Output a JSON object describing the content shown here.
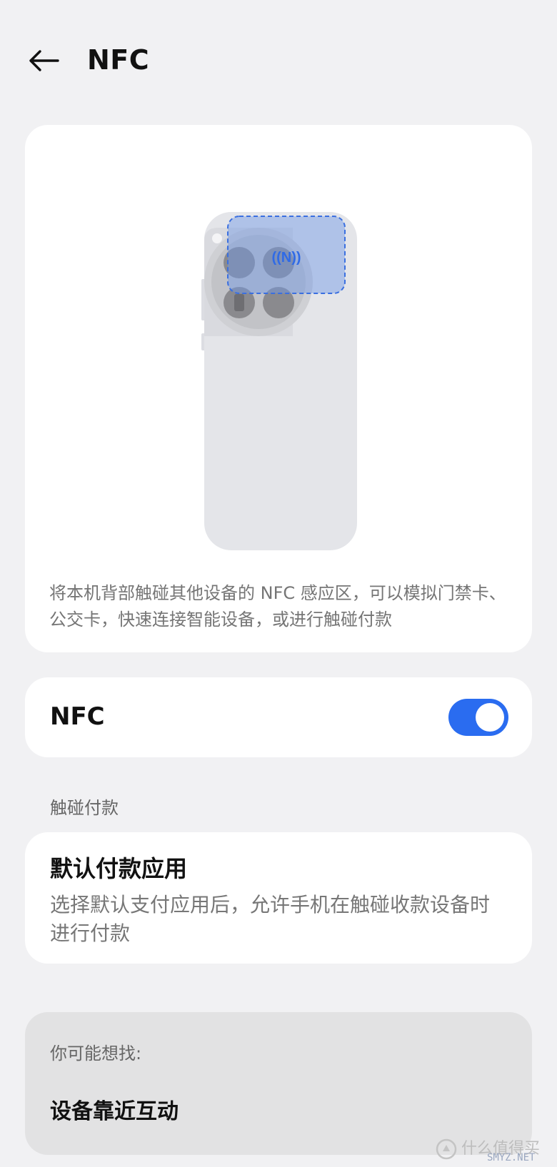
{
  "header": {
    "title": "NFC",
    "back_icon": "arrow-left-icon"
  },
  "illustration": {
    "nfc_mark": "((N))",
    "description": "将本机背部触碰其他设备的 NFC 感应区，可以模拟门禁卡、公交卡，快速连接智能设备，或进行触碰付款"
  },
  "nfc_setting": {
    "label": "NFC",
    "enabled": true,
    "accent_color": "#2a6cf0"
  },
  "payment_section": {
    "title": "触碰付款",
    "item": {
      "title": "默认付款应用",
      "description": "选择默认支付应用后，允许手机在触碰收款设备时进行付款"
    }
  },
  "suggestions": {
    "title": "你可能想找:",
    "items": [
      "设备靠近互动"
    ]
  },
  "watermark": {
    "text": "什么值得买",
    "sub": "SMYZ.NET"
  }
}
